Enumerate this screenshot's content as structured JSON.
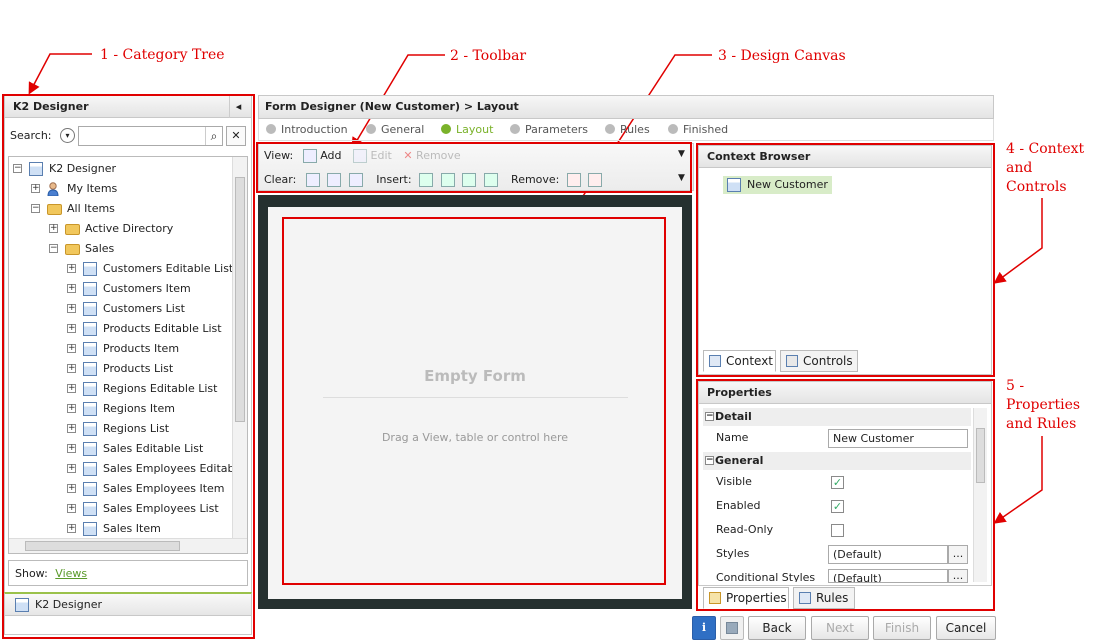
{
  "annotations": {
    "a1": "1 - Category Tree",
    "a2": "2 - Toolbar",
    "a3": "3 - Design Canvas",
    "a4": [
      "4 - Context",
      "and",
      "Controls"
    ],
    "a5": [
      "5 -",
      "Properties",
      "and Rules"
    ]
  },
  "left": {
    "title": "K2 Designer",
    "search_label": "Search:",
    "tree": [
      {
        "label": "K2 Designer",
        "level": 0,
        "pm": "−",
        "icon": "form"
      },
      {
        "label": "My Items",
        "level": 1,
        "pm": "+",
        "icon": "user"
      },
      {
        "label": "All Items",
        "level": 1,
        "pm": "−",
        "icon": "folder"
      },
      {
        "label": "Active Directory",
        "level": 2,
        "pm": "+",
        "icon": "folder"
      },
      {
        "label": "Sales",
        "level": 2,
        "pm": "−",
        "icon": "folder"
      },
      {
        "label": "Customers Editable List",
        "level": 3,
        "pm": "+",
        "icon": "form"
      },
      {
        "label": "Customers Item",
        "level": 3,
        "pm": "+",
        "icon": "form"
      },
      {
        "label": "Customers List",
        "level": 3,
        "pm": "+",
        "icon": "form"
      },
      {
        "label": "Products Editable List",
        "level": 3,
        "pm": "+",
        "icon": "form"
      },
      {
        "label": "Products Item",
        "level": 3,
        "pm": "+",
        "icon": "form"
      },
      {
        "label": "Products List",
        "level": 3,
        "pm": "+",
        "icon": "form"
      },
      {
        "label": "Regions Editable List",
        "level": 3,
        "pm": "+",
        "icon": "form"
      },
      {
        "label": "Regions Item",
        "level": 3,
        "pm": "+",
        "icon": "form"
      },
      {
        "label": "Regions List",
        "level": 3,
        "pm": "+",
        "icon": "form"
      },
      {
        "label": "Sales Editable List",
        "level": 3,
        "pm": "+",
        "icon": "form"
      },
      {
        "label": "Sales Employees Editable List",
        "level": 3,
        "pm": "+",
        "icon": "form"
      },
      {
        "label": "Sales Employees Item",
        "level": 3,
        "pm": "+",
        "icon": "form"
      },
      {
        "label": "Sales Employees List",
        "level": 3,
        "pm": "+",
        "icon": "form"
      },
      {
        "label": "Sales Item",
        "level": 3,
        "pm": "+",
        "icon": "form"
      }
    ],
    "show_label": "Show:",
    "show_link": "Views",
    "footer": "K2 Designer"
  },
  "center": {
    "title": "Form Designer (New Customer) > Layout",
    "steps": [
      "Introduction",
      "General",
      "Layout",
      "Parameters",
      "Rules",
      "Finished"
    ],
    "active_step": "Layout",
    "toolbar": {
      "view_label": "View:",
      "add": "Add",
      "edit": "Edit",
      "remove": "Remove",
      "clear_label": "Clear:",
      "insert_label": "Insert:",
      "remove_label": "Remove:"
    },
    "canvas": {
      "empty_title": "Empty Form",
      "hint": "Drag a View, table or control here"
    }
  },
  "context": {
    "title": "Context Browser",
    "item": "New Customer",
    "tab_context": "Context",
    "tab_controls": "Controls"
  },
  "properties": {
    "title": "Properties",
    "sec_detail": "Detail",
    "name_label": "Name",
    "name_value": "New Customer",
    "sec_general": "General",
    "visible_label": "Visible",
    "enabled_label": "Enabled",
    "readonly_label": "Read-Only",
    "styles_label": "Styles",
    "styles_value": "(Default)",
    "cond_label": "Conditional Styles",
    "cond_value": "(Default)",
    "ellipsis": "...",
    "tab_properties": "Properties",
    "tab_rules": "Rules"
  },
  "footer_buttons": {
    "back": "Back",
    "next": "Next",
    "finish": "Finish",
    "cancel": "Cancel"
  },
  "colors": {
    "annotation": "#e00000",
    "link": "#5a9a2a",
    "active_step": "#7ab22a"
  }
}
